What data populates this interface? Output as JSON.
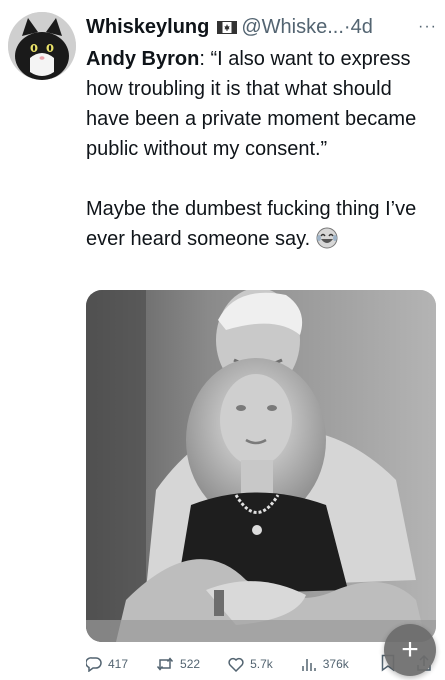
{
  "tweet": {
    "display_name": "Whiskeylung",
    "flag_icon": "canada-flag-icon",
    "handle": "@Whiske...",
    "separator": "·",
    "time": "4d",
    "more_icon": "more-dots-icon",
    "more_label": "···",
    "quote_name": "Andy Byron",
    "quote_text": ": “I also want to express how troubling it is that what should have been a private moment became public without my consent.”",
    "comment": "Maybe the dumbest fucking thing I’ve ever heard someone say.",
    "comment_emoji": "laughing-crying-emoji"
  },
  "actions": {
    "replies": "417",
    "reposts": "522",
    "likes": "5.7k",
    "views": "376k"
  },
  "fab": {
    "label": "+",
    "icon": "compose-plus-icon"
  },
  "colors": {
    "text": "#0f1419",
    "secondary": "#536471",
    "fab": "#6c6c6c"
  }
}
